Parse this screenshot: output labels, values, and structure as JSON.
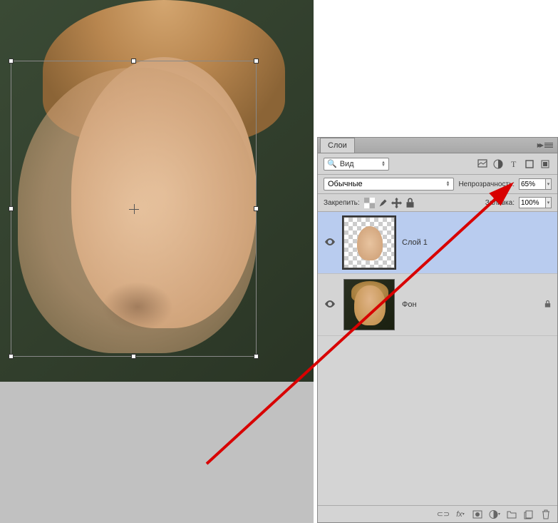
{
  "panel": {
    "title": "Слои",
    "filter_label": "Вид"
  },
  "blend": {
    "mode": "Обычные",
    "opacity_label": "Непрозрачность:",
    "opacity_value": "65%",
    "fill_label": "Заливка:",
    "fill_value": "100%"
  },
  "lock": {
    "label": "Закрепить:"
  },
  "layers": [
    {
      "name": "Слой 1",
      "visible": true,
      "selected": true,
      "locked": false
    },
    {
      "name": "Фон",
      "visible": true,
      "selected": false,
      "locked": true
    }
  ]
}
